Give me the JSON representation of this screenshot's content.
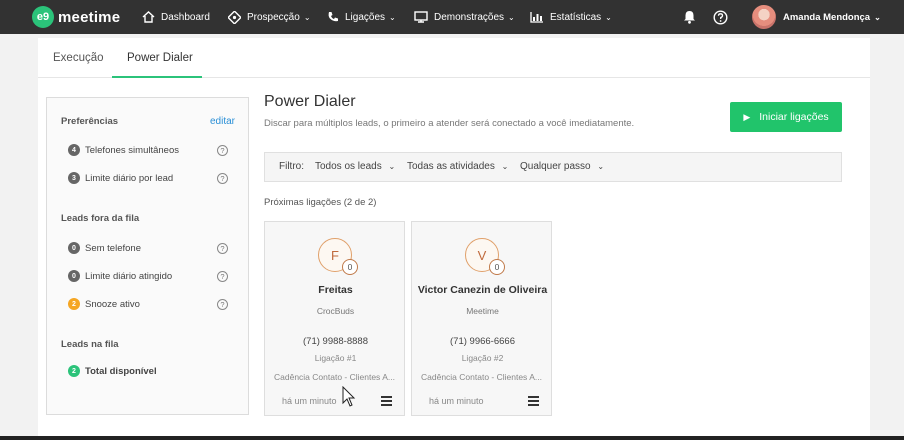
{
  "topbar": {
    "logo_mark": "e9",
    "logo_text": "meetime",
    "nav": [
      {
        "label": "Dashboard",
        "icon": "home-icon"
      },
      {
        "label": "Prospecção",
        "icon": "target-icon"
      },
      {
        "label": "Ligações",
        "icon": "phone-icon"
      },
      {
        "label": "Demonstrações",
        "icon": "monitor-icon"
      },
      {
        "label": "Estatísticas",
        "icon": "chart-icon"
      }
    ],
    "user_name": "Amanda Mendonça"
  },
  "tabs": [
    {
      "label": "Execução",
      "active": false
    },
    {
      "label": "Power Dialer",
      "active": true
    }
  ],
  "sidebar": {
    "preferences_title": "Preferências",
    "edit_label": "editar",
    "preferences": [
      {
        "count": "4",
        "label": "Telefones simultâneos"
      },
      {
        "count": "3",
        "label": "Limite diário por lead"
      }
    ],
    "out_title": "Leads fora da fila",
    "out_items": [
      {
        "count": "0",
        "label": "Sem telefone"
      },
      {
        "count": "0",
        "label": "Limite diário atingido"
      },
      {
        "count": "2",
        "label": "Snooze ativo"
      }
    ],
    "queue_title": "Leads na fila",
    "queue_items": [
      {
        "count": "2",
        "label": "Total disponível"
      }
    ]
  },
  "content": {
    "title": "Power Dialer",
    "subtitle": "Discar para múltiplos leads, o primeiro a atender será conectado a você imediatamente.",
    "start_button": "Iniciar ligações",
    "filter": {
      "label": "Filtro:",
      "leads": "Todos os leads",
      "activities": "Todas as atividades",
      "step": "Qualquer passo"
    },
    "next_calls_label": "Próximas ligações (2 de 2)",
    "cards": [
      {
        "initial": "F",
        "count": "0",
        "name": "Freitas",
        "company": "CrocBuds",
        "phone": "(71) 9988-8888",
        "call": "Ligação #1",
        "cadence": "Cadência Contato - Clientes A...",
        "time": "há um minuto"
      },
      {
        "initial": "V",
        "count": "0",
        "name": "Victor Canezin de Oliveira",
        "company": "Meetime",
        "phone": "(71) 9966-6666",
        "call": "Ligação #2",
        "cadence": "Cadência Contato - Clientes A...",
        "time": "há um minuto"
      }
    ]
  },
  "colors": {
    "topbar": "#323232",
    "accent_green": "#21c46b",
    "link_blue": "#2a8fd6",
    "snooze_orange": "#f5a623"
  }
}
